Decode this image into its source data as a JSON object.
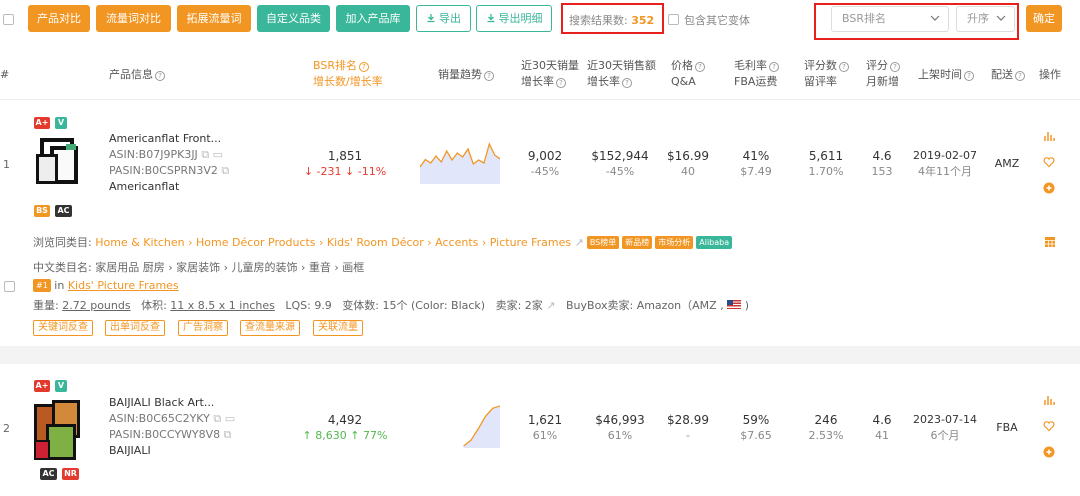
{
  "toolbar": {
    "buttons": [
      "产品对比",
      "流量词对比",
      "拓展流量词",
      "自定义品类",
      "加入产品库",
      "导出",
      "导出明细"
    ],
    "result_label": "搜索结果数:",
    "result_count": "352",
    "include_variants": "包含其它变体",
    "sort_field": "BSR排名",
    "sort_order": "升序",
    "confirm": "确定"
  },
  "header": {
    "col_index": "#",
    "col_product": "产品信息",
    "col_bsr_1": "BSR排名",
    "col_bsr_2": "增长数/增长率",
    "col_trend": "销量趋势",
    "col_sales_1": "近30天销量",
    "col_sales_2": "增长率",
    "col_rev_1": "近30天销售额",
    "col_rev_2": "增长率",
    "col_price_1": "价格",
    "col_price_2": "Q&A",
    "col_margin_1": "毛利率",
    "col_margin_2": "FBA运费",
    "col_rating_1": "评分数",
    "col_rating_2": "留评率",
    "col_score_1": "评分",
    "col_score_2": "月新增",
    "col_date": "上架时间",
    "col_ship": "配送",
    "col_op": "操作"
  },
  "products": [
    {
      "index": "1",
      "badge_top": [
        "A+",
        "V"
      ],
      "badge_bottom": [
        "BS",
        "AC"
      ],
      "name": "Americanflat Front...",
      "asin": "ASIN:B07J9PK3JJ",
      "pasin": "PASIN:B0CSPRN3V2",
      "brand": "Americanflat",
      "bsr": "1,851",
      "bsr_change": "-231",
      "bsr_rate": "-11%",
      "sales": "9,002",
      "sales_rate": "-45%",
      "revenue": "$152,944",
      "revenue_rate": "-45%",
      "price": "$16.99",
      "qa": "40",
      "margin": "41%",
      "fba": "$7.49",
      "ratings": "5,611",
      "review_rate": "1.70%",
      "score": "4.6",
      "monthly_new": "153",
      "date": "2019-02-07",
      "age": "4年11个月",
      "ship": "AMZ",
      "trend": [
        30,
        45,
        38,
        52,
        40,
        62,
        44,
        58,
        50,
        66,
        36,
        44,
        38,
        76,
        54,
        46
      ],
      "category_label": "浏览同类目:",
      "category_path": "Home & Kitchen › Home Décor Products › Kids' Room Décor › Accents › Picture Frames",
      "cat_tags": [
        "BS榜单",
        "新品榜",
        "市场分析",
        "Alibaba"
      ],
      "cn_category": "中文类目名: 家居用品 厨房 › 家居装饰 › 儿童房的装饰 › 重音 › 画框",
      "rank_badge": "#1",
      "rank_in": "in",
      "rank_cat": "Kids' Picture Frames",
      "weight_label": "重量:",
      "weight": "2.72 pounds",
      "size_label": "体积:",
      "size": "11 x 8.5 x 1 inches",
      "lqs": "LQS: 9.9",
      "variants": "变体数: 15个 (Color: Black)",
      "sellers": "卖家: 2家",
      "buybox": "BuyBox卖家: Amazon（AMZ ,",
      "buybox_end": ")",
      "actions": [
        "关键词反查",
        "出单词反查",
        "广告洞察",
        "查流量来源",
        "关联流量"
      ]
    },
    {
      "index": "2",
      "badge_top": [
        "A+",
        "V"
      ],
      "badge_bottom": [
        "AC",
        "NR"
      ],
      "name": "BAIJIALI Black Art...",
      "asin": "ASIN:B0C65C2YKY",
      "pasin": "PASIN:B0CCYWY8V8",
      "brand": "BAIJIALI",
      "bsr": "4,492",
      "bsr_change": "8,630",
      "bsr_rate": "77%",
      "sales": "1,621",
      "sales_rate": "61%",
      "revenue": "$46,993",
      "revenue_rate": "61%",
      "price": "$28.99",
      "qa": "-",
      "margin": "59%",
      "fba": "$7.65",
      "ratings": "246",
      "review_rate": "2.53%",
      "score": "4.6",
      "monthly_new": "41",
      "date": "2023-07-14",
      "age": "6个月",
      "ship": "FBA",
      "trend": [
        0,
        0,
        0,
        0,
        0,
        0,
        0,
        10,
        30,
        52,
        66,
        70
      ]
    }
  ],
  "colors": {
    "orange": "#f29623",
    "green": "#3ab79a",
    "red": "#e23b2e",
    "up": "#52b84d",
    "highlight": "#e8201b"
  }
}
